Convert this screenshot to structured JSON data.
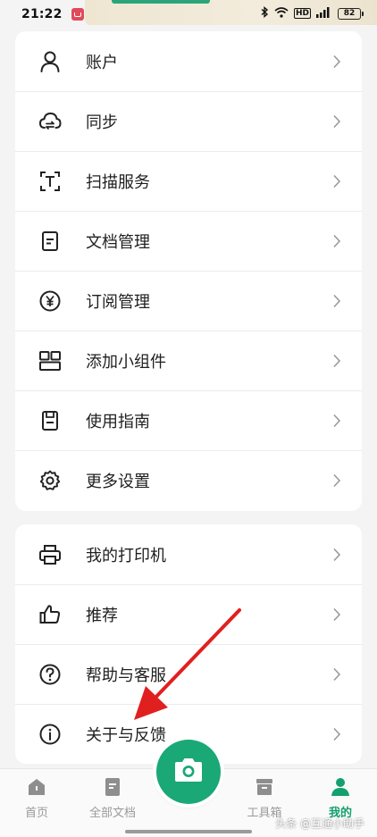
{
  "status_bar": {
    "time": "21:22",
    "battery": "82",
    "network_label": "HD"
  },
  "menu_group_1": {
    "items": [
      {
        "label": "账户",
        "icon": "user-icon"
      },
      {
        "label": "同步",
        "icon": "cloud-sync-icon"
      },
      {
        "label": "扫描服务",
        "icon": "scan-text-icon"
      },
      {
        "label": "文档管理",
        "icon": "document-icon"
      },
      {
        "label": "订阅管理",
        "icon": "yen-icon"
      },
      {
        "label": "添加小组件",
        "icon": "widgets-icon"
      },
      {
        "label": "使用指南",
        "icon": "guide-icon"
      },
      {
        "label": "更多设置",
        "icon": "gear-icon"
      }
    ]
  },
  "menu_group_2": {
    "items": [
      {
        "label": "我的打印机",
        "icon": "printer-icon"
      },
      {
        "label": "推荐",
        "icon": "thumbs-up-icon"
      },
      {
        "label": "帮助与客服",
        "icon": "help-icon"
      },
      {
        "label": "关于与反馈",
        "icon": "info-icon"
      }
    ]
  },
  "bottom_nav": {
    "home": "首页",
    "all_docs": "全部文档",
    "tools": "工具箱",
    "mine": "我的",
    "active": "mine"
  },
  "watermark": "头条 @互通小助手",
  "colors": {
    "accent": "#1aa877",
    "annotation_arrow": "#e0201f",
    "background": "#f4f4f4"
  }
}
